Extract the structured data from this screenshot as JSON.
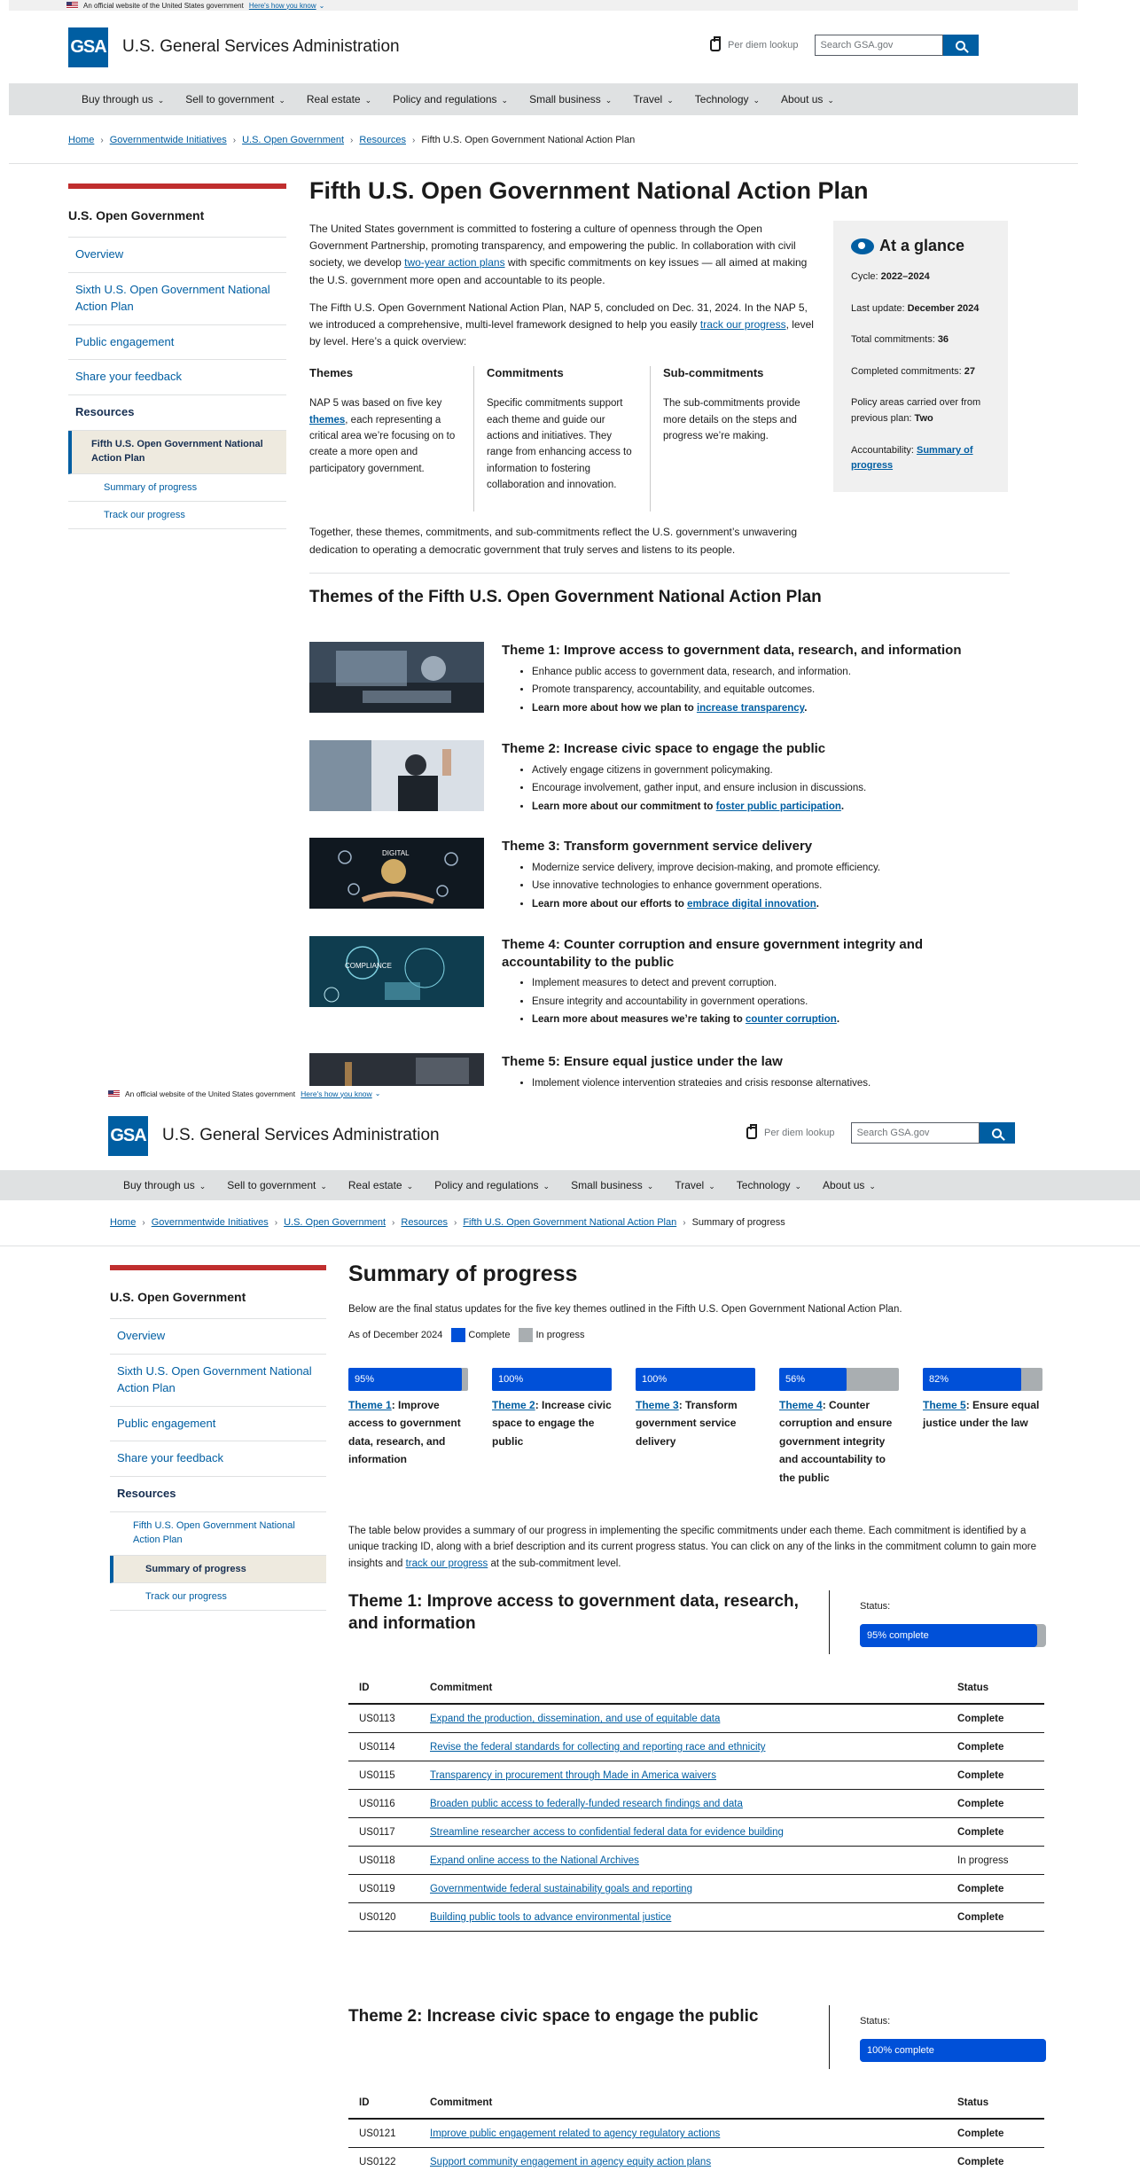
{
  "banner": {
    "text": "An official website of the United States government",
    "link": "Here's how you know"
  },
  "header": {
    "logo": "GSA",
    "title": "U.S. General Services Administration",
    "per_diem": "Per diem lookup",
    "search_placeholder": "Search GSA.gov"
  },
  "nav": [
    "Buy through us",
    "Sell to government",
    "Real estate",
    "Policy and regulations",
    "Small business",
    "Travel",
    "Technology",
    "About us"
  ],
  "sidenav": {
    "title": "U.S. Open Government",
    "items": [
      "Overview",
      "Sixth U.S. Open Government National Action Plan",
      "Public engagement",
      "Share your feedback",
      "Resources"
    ],
    "sub": "Fifth U.S. Open Government National Action Plan",
    "subsub": [
      "Summary of progress",
      "Track our progress"
    ]
  },
  "page1": {
    "breadcrumb": [
      "Home",
      "Governmentwide Initiatives",
      "U.S. Open Government",
      "Resources",
      "Fifth U.S. Open Government National Action Plan"
    ],
    "title": "Fifth U.S. Open Government National Action Plan",
    "intro1_a": "The United States government is committed to fostering a culture of openness through the Open Government Partnership, promoting transparency, and empowering the public. In collaboration with civil society, we develop ",
    "intro1_link": "two-year action plans",
    "intro1_b": " with specific commitments on key issues — all aimed at making the U.S. government more open and accountable to its people.",
    "intro2_a": "The Fifth U.S. Open Government National Action Plan, NAP 5, concluded on Dec. 31, 2024. In the NAP 5, we introduced a comprehensive, multi-level framework designed to help you easily ",
    "intro2_link": "track our progress",
    "intro2_b": ", level by level. Here’s a quick overview:",
    "glance": {
      "title": "At a glance",
      "cycle_label": "Cycle: ",
      "cycle": "2022–2024",
      "update_label": "Last update: ",
      "update": "December 2024",
      "total_label": "Total commitments: ",
      "total": "36",
      "completed_label": "Completed commitments: ",
      "completed": "27",
      "carried_label": "Policy areas carried over from previous plan: ",
      "carried": "Two",
      "acc_label": "Accountability: ",
      "acc_link": "Summary of progress"
    },
    "cols": [
      {
        "h": "Themes",
        "a": "NAP 5 was based on five key ",
        "link": "themes",
        "b": ", each representing a critical area we’re focusing on to create a more open and participatory government."
      },
      {
        "h": "Commitments",
        "a": "Specific commitments support each theme and guide our actions and initiatives. They range from enhancing access to information to fostering collaboration and innovation.",
        "link": "",
        "b": ""
      },
      {
        "h": "Sub-commitments",
        "a": "The sub-commitments provide more details on the steps and progress we’re making.",
        "link": "",
        "b": ""
      }
    ],
    "together": "Together, these themes, commitments, and sub-commitments reflect the U.S. government’s unwavering dedication to operating a democratic government that truly serves and listens to its people.",
    "themes_heading": "Themes of the Fifth U.S. Open Government National Action Plan",
    "themes": [
      {
        "title": "Theme 1: Improve access to government data, research, and information",
        "b1": "Enhance public access to government data, research, and information.",
        "b2": "Promote transparency, accountability, and equitable outcomes.",
        "lm": "Learn more about how we plan to ",
        "link": "increase transparency",
        "img_label": ""
      },
      {
        "title": "Theme 2: Increase civic space to engage the public",
        "b1": "Actively engage citizens in government policymaking.",
        "b2": "Encourage involvement, gather input, and ensure inclusion in discussions.",
        "lm": "Learn more about our commitment to ",
        "link": "foster public participation",
        "img_label": ""
      },
      {
        "title": "Theme 3: Transform government service delivery",
        "b1": "Modernize service delivery, improve decision-making, and promote efficiency.",
        "b2": "Use innovative technologies to enhance government operations.",
        "lm": "Learn more about our efforts to ",
        "link": "embrace digital innovation",
        "img_label": "DIGITAL"
      },
      {
        "title": "Theme 4: Counter corruption and ensure government integrity and accountability to the public",
        "b1": "Implement measures to detect and prevent corruption.",
        "b2": "Ensure integrity and accountability in government operations.",
        "lm": "Learn more about measures we’re taking to ",
        "link": "counter corruption",
        "img_label": "COMPLIANCE"
      },
      {
        "title": "Theme 5: Ensure equal justice under the law",
        "b1": "Implement violence intervention strategies and crisis response alternatives.",
        "b2": "",
        "lm": "",
        "link": "",
        "img_label": ""
      }
    ]
  },
  "page2": {
    "breadcrumb": [
      "Home",
      "Governmentwide Initiatives",
      "U.S. Open Government",
      "Resources",
      "Fifth U.S. Open Government National Action Plan",
      "Summary of progress"
    ],
    "title": "Summary of progress",
    "intro": "Below are the final status updates for the five key themes outlined in the Fifth U.S. Open Government National Action Plan.",
    "asof": "As of December 2024",
    "legend_complete": "Complete",
    "legend_progress": "In progress",
    "colors": {
      "complete": "#0050d8",
      "in_progress": "#a9aeb1"
    },
    "progress": [
      {
        "pct": "95%",
        "value": 0.95,
        "link": "Theme 1",
        "rest": ": Improve access to government data, research, and information"
      },
      {
        "pct": "100%",
        "value": 1.0,
        "link": "Theme 2",
        "rest": ": Increase civic space to engage the public"
      },
      {
        "pct": "100%",
        "value": 1.0,
        "link": "Theme 3",
        "rest": ": Transform government service delivery"
      },
      {
        "pct": "56%",
        "value": 0.56,
        "link": "Theme 4",
        "rest": ": Counter corruption and ensure government integrity and accountability to the public"
      },
      {
        "pct": "82%",
        "value": 0.82,
        "link": "Theme 5",
        "rest": ": Ensure equal justice under the law"
      }
    ],
    "table_intro_a": "The table below provides a summary of our progress in implementing the specific commitments under each theme. Each commitment is identified by a unique tracking ID, along with a brief description and its current progress status. You can click on any of the links in the commitment column to gain more insights and ",
    "table_intro_link": "track our progress",
    "table_intro_b": " at the sub-commitment level.",
    "status_label": "Status:",
    "cols": [
      "ID",
      "Commitment",
      "Status"
    ],
    "theme1": {
      "title": "Theme 1: Improve access to government data, research, and information",
      "status": "95% complete",
      "value": 0.95,
      "rows": [
        {
          "id": "US0113",
          "c": "Expand the production, dissemination, and use of equitable data",
          "s": "Complete"
        },
        {
          "id": "US0114",
          "c": "Revise the federal standards for collecting and reporting race and ethnicity",
          "s": "Complete"
        },
        {
          "id": "US0115",
          "c": "Transparency in procurement through Made in America waivers",
          "s": "Complete"
        },
        {
          "id": "US0116",
          "c": "Broaden public access to federally-funded research findings and data",
          "s": "Complete"
        },
        {
          "id": "US0117",
          "c": "Streamline researcher access to confidential federal data for evidence building",
          "s": "Complete"
        },
        {
          "id": "US0118",
          "c": "Expand online access to the National Archives",
          "s": "In progress"
        },
        {
          "id": "US0119",
          "c": "Governmentwide federal sustainability goals and reporting",
          "s": "Complete"
        },
        {
          "id": "US0120",
          "c": "Building public tools to advance environmental justice",
          "s": "Complete"
        }
      ]
    },
    "theme2": {
      "title": "Theme 2: Increase civic space to engage the public",
      "status": "100% complete",
      "value": 1.0,
      "rows": [
        {
          "id": "US0121",
          "c": "Improve public engagement related to agency regulatory actions",
          "s": "Complete"
        },
        {
          "id": "US0122",
          "c": "Support community engagement in agency equity action plans",
          "s": "Complete"
        }
      ]
    }
  }
}
